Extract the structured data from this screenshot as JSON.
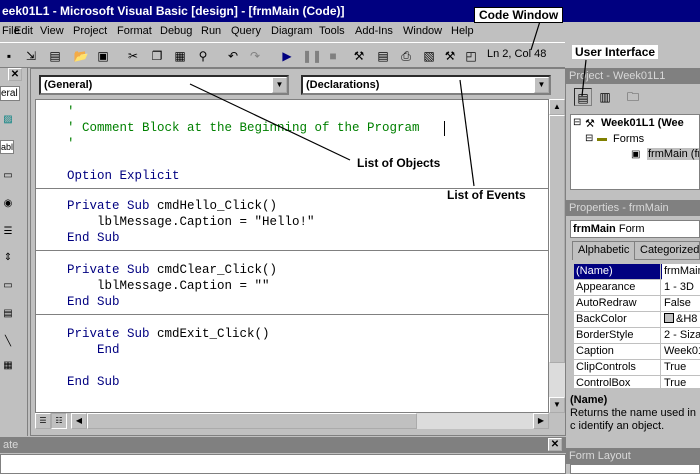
{
  "window": {
    "title": "eek01L1 - Microsoft Visual Basic [design] - [frmMain (Code)]"
  },
  "menu": {
    "items": [
      "File",
      "Edit",
      "View",
      "Project",
      "Format",
      "Debug",
      "Run",
      "Query",
      "Diagram",
      "Tools",
      "Add-Ins",
      "Window",
      "Help"
    ]
  },
  "toolbar": {
    "position": "Ln 2, Col 48"
  },
  "toolbox": {
    "items": [
      "eral",
      "abl"
    ]
  },
  "code_window": {
    "object_combo": "(General)",
    "procedure_combo": "(Declarations)",
    "lines": {
      "l1": "'",
      "l2": "' Comment Block at the Beginning of the Program",
      "l3": "'",
      "l4": "Option Explicit",
      "l5a": "Private Sub",
      "l5b": " cmdHello_Click()",
      "l6": "    lblMessage.Caption = \"Hello!\"",
      "l7": "End Sub",
      "l8a": "Private Sub",
      "l8b": " cmdClear_Click()",
      "l9": "    lblMessage.Caption = \"\"",
      "l10": "End Sub",
      "l11a": "Private Sub",
      "l11b": " cmdExit_Click()",
      "l12": "    End",
      "l13": "End Sub"
    }
  },
  "annotations": {
    "code_window": "Code Window",
    "user_interface": "User Interface",
    "list_of_objects": "List of Objects",
    "list_of_events": "List of Events"
  },
  "project_panel": {
    "title": "Project - Week01L1",
    "project_name": "Week01L1 (Wee",
    "forms_folder": "Forms",
    "form_item": "frmMain (fr"
  },
  "properties_panel": {
    "title": "Properties - frmMain",
    "object_name": "frmMain",
    "object_type": "Form",
    "tab_alphabetic": "Alphabetic",
    "tab_categorized": "Categorized",
    "rows": [
      {
        "name": "(Name)",
        "value": "frmMain"
      },
      {
        "name": "Appearance",
        "value": "1 - 3D"
      },
      {
        "name": "AutoRedraw",
        "value": "False"
      },
      {
        "name": "BackColor",
        "value": "&H8"
      },
      {
        "name": "BorderStyle",
        "value": "2 - Sizab"
      },
      {
        "name": "Caption",
        "value": "Week01"
      },
      {
        "name": "ClipControls",
        "value": "True"
      },
      {
        "name": "ControlBox",
        "value": "True"
      }
    ],
    "desc_title": "(Name)",
    "desc_text": "Returns the name used in c identify an object."
  },
  "form_layout": {
    "title": "Form Layout"
  },
  "immediate": {
    "title": "ate"
  },
  "colors": {
    "title_bar": "#000080",
    "keyword": "#000080",
    "comment": "#008000",
    "face": "#c0c0c0"
  }
}
